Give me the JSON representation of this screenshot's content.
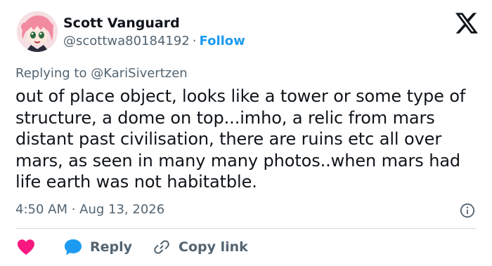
{
  "author": {
    "name": "Scott Vanguard",
    "handle": "@scottwa80184192",
    "separator": "·",
    "follow_label": "Follow"
  },
  "reply_context": {
    "prefix": "Replying to",
    "mention": "@KariSivertzen"
  },
  "tweet": {
    "text": "out of place object, looks like a tower or some type of structure, a dome on top...imho, a relic from mars distant past civilisation, there are ruins etc all over mars, as seen in many many photos..when mars had life earth was not habitatble.",
    "timestamp": "4:50 AM · Aug 13, 2026"
  },
  "actions": {
    "reply_label": "Reply",
    "copy_link_label": "Copy link"
  },
  "icons": {
    "logo": "x-logo-icon",
    "info": "info-icon",
    "like": "heart-icon",
    "reply": "speech-bubble-icon",
    "copy": "link-icon"
  },
  "colors": {
    "accent": "#1d9bf0",
    "text": "#0f1419",
    "secondary": "#536471",
    "heart": "#f91880",
    "divider": "#cfd9de"
  }
}
